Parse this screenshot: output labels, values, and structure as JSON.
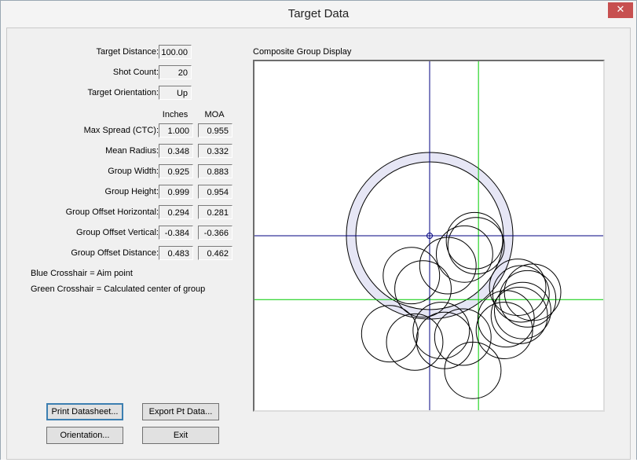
{
  "window": {
    "title": "Target Data",
    "close_glyph": "✕"
  },
  "fields": {
    "target_distance": {
      "label": "Target Distance:",
      "value": "100.00"
    },
    "shot_count": {
      "label": "Shot Count:",
      "value": "20"
    },
    "target_orientation": {
      "label": "Target Orientation:",
      "value": "Up"
    }
  },
  "columns": {
    "inches": "Inches",
    "moa": "MOA"
  },
  "stats": [
    {
      "label": "Max Spread (CTC):",
      "inches": "1.000",
      "moa": "0.955"
    },
    {
      "label": "Mean Radius:",
      "inches": "0.348",
      "moa": "0.332"
    },
    {
      "label": "Group Width:",
      "inches": "0.925",
      "moa": "0.883"
    },
    {
      "label": "Group Height:",
      "inches": "0.999",
      "moa": "0.954"
    },
    {
      "label": "Group Offset Horizontal:",
      "inches": "0.294",
      "moa": "0.281"
    },
    {
      "label": "Group Offset Vertical:",
      "inches": "-0.384",
      "moa": "-0.366"
    },
    {
      "label": "Group Offset Distance:",
      "inches": "0.483",
      "moa": "0.462"
    }
  ],
  "notes": {
    "blue": "Blue Crosshair = Aim point",
    "green": "Green Crosshair = Calculated center of group"
  },
  "buttons": {
    "print": "Print Datasheet...",
    "export": "Export Pt Data...",
    "orientation": "Orientation...",
    "exit": "Exit"
  },
  "display": {
    "title": "Composite Group Display",
    "aim_color": "#000080",
    "center_color": "#00cc00",
    "ring_fill": "#e6e6f5",
    "mean_radius_in": 0.348,
    "bullet_diameter_in": 0.17,
    "offset_horizontal_in": 0.294,
    "offset_vertical_in": -0.384,
    "scale_range_in": 2.1,
    "shots_in": [
      [
        0.11,
        -0.18
      ],
      [
        0.21,
        -0.11
      ],
      [
        0.28,
        -0.06
      ],
      [
        0.27,
        -0.03
      ],
      [
        -0.11,
        -0.24
      ],
      [
        -0.04,
        -0.32
      ],
      [
        0.53,
        -0.31
      ],
      [
        0.62,
        -0.34
      ],
      [
        0.55,
        -0.35
      ],
      [
        0.59,
        -0.38
      ],
      [
        0.56,
        -0.45
      ],
      [
        0.54,
        -0.48
      ],
      [
        0.46,
        -0.5
      ],
      [
        0.45,
        -0.57
      ],
      [
        -0.24,
        -0.59
      ],
      [
        -0.09,
        -0.64
      ],
      [
        0.09,
        -0.63
      ],
      [
        0.2,
        -0.61
      ],
      [
        0.07,
        -0.57
      ],
      [
        0.26,
        -0.81
      ]
    ]
  }
}
